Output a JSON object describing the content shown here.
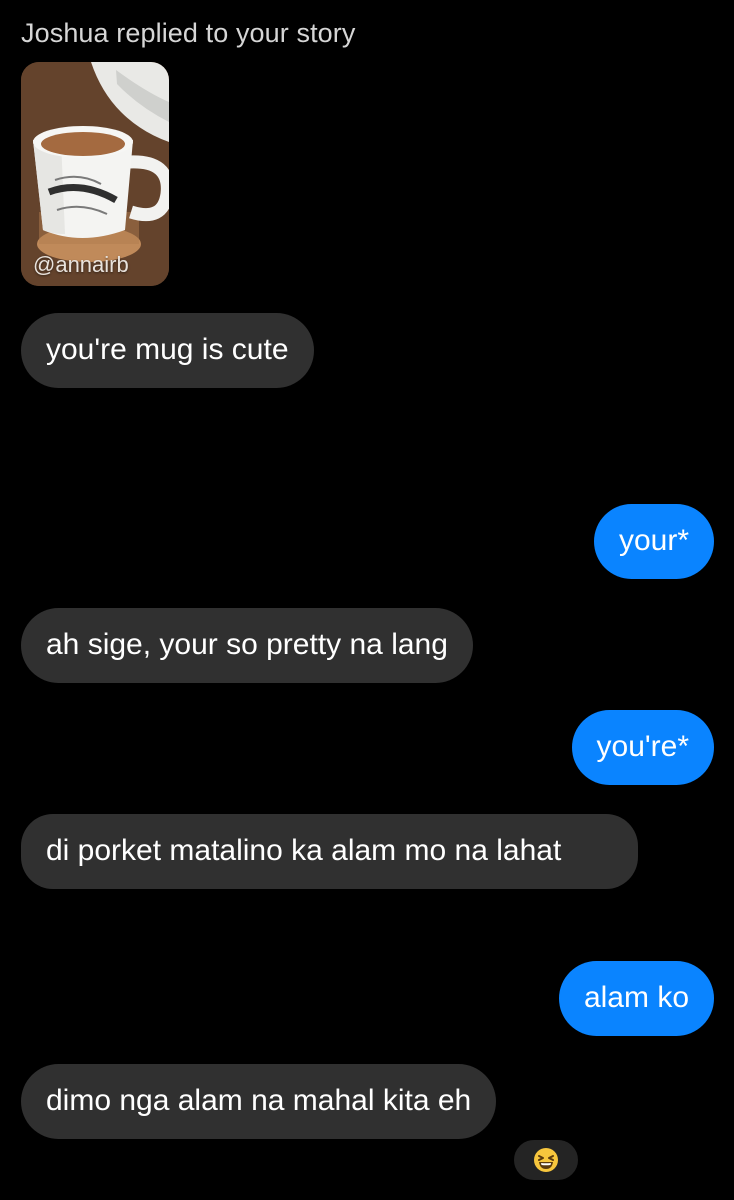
{
  "header": {
    "title": "Joshua replied to your story"
  },
  "story": {
    "handle": "@annairb"
  },
  "messages": [
    {
      "side": "incoming",
      "text": "you're mug is cute"
    },
    {
      "side": "outgoing",
      "text": "your*"
    },
    {
      "side": "incoming",
      "text": "ah sige, your so pretty na lang"
    },
    {
      "side": "outgoing",
      "text": "you're*"
    },
    {
      "side": "incoming",
      "text": "di porket matalino ka alam mo na lahat"
    },
    {
      "side": "outgoing",
      "text": "alam ko"
    },
    {
      "side": "incoming",
      "text": "dimo nga alam na mahal kita eh"
    }
  ],
  "reaction": {
    "icon": "laughing-squinting-face-emoji"
  },
  "colors": {
    "background": "#000000",
    "incoming_bubble": "#303030",
    "outgoing_bubble": "#0a84ff",
    "header_text": "#d6d6d6"
  }
}
